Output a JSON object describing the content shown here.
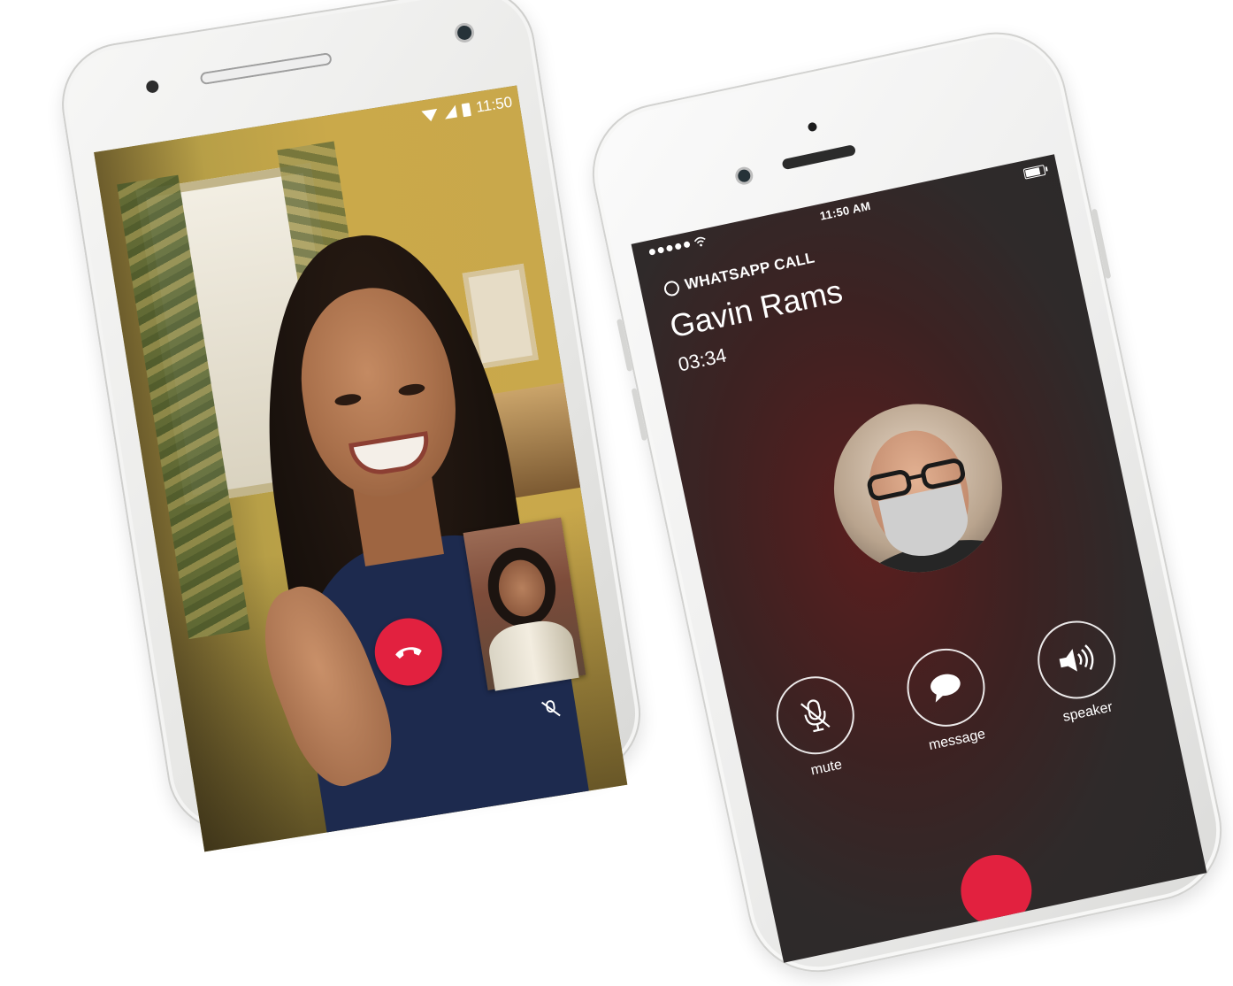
{
  "android": {
    "status_time": "11:50",
    "icons": {
      "wifi": "wifi-icon",
      "signal": "signal-icon",
      "battery": "battery-icon",
      "end_call": "end-call-icon",
      "mute": "mute-icon"
    }
  },
  "iphone": {
    "status_time": "11:50 AM",
    "header": "WHATSAPP CALL",
    "contact_name": "Gavin Rams",
    "call_duration": "03:34",
    "controls": [
      {
        "label": "mute",
        "icon": "mic-off-icon"
      },
      {
        "label": "message",
        "icon": "chat-bubble-icon"
      },
      {
        "label": "speaker",
        "icon": "speaker-icon"
      }
    ]
  },
  "colors": {
    "end_call_red": "#e2213f",
    "ios_screen_bg": "#2f2a2a",
    "android_wall": "#caa94a"
  }
}
